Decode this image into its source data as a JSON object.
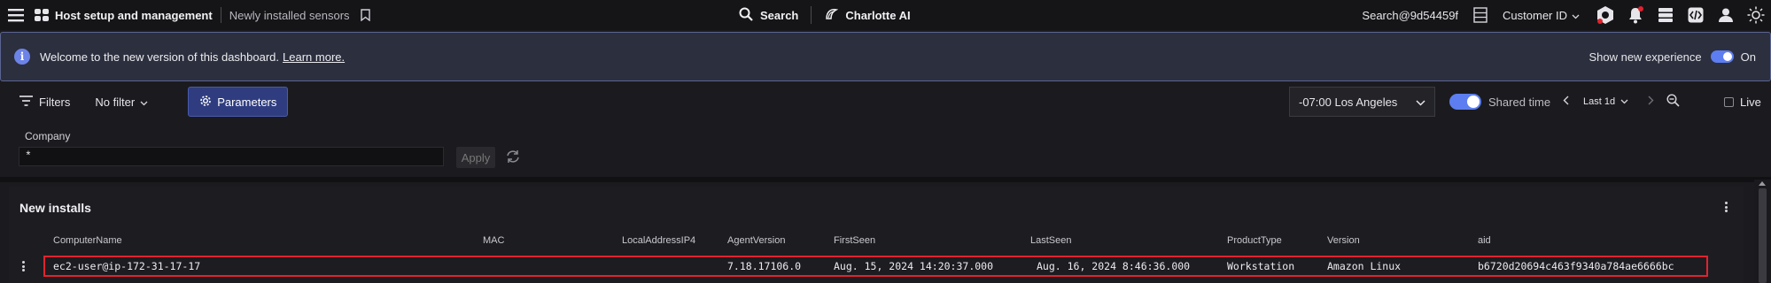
{
  "topbar": {
    "app_title": "Host setup and management",
    "subtitle": "Newly installed sensors",
    "search_label": "Search",
    "charlotte_label": "Charlotte AI",
    "search_id": "Search@9d54459f",
    "customer_label": "Customer ID"
  },
  "banner": {
    "message": "Welcome to the new version of this dashboard.",
    "link": "Learn more.",
    "toggle_label": "Show new experience",
    "toggle_state": "On"
  },
  "filterbar": {
    "filters_label": "Filters",
    "no_filter_label": "No filter",
    "parameters_label": "Parameters",
    "timezone": "-07:00 Los Angeles",
    "shared_time_label": "Shared time",
    "range": "Last 1d",
    "live_label": "Live"
  },
  "params": {
    "company_label": "Company",
    "company_value": "*",
    "apply_label": "Apply"
  },
  "panel": {
    "title": "New installs",
    "columns": [
      "ComputerName",
      "MAC",
      "LocalAddressIP4",
      "AgentVersion",
      "FirstSeen",
      "LastSeen",
      "ProductType",
      "Version",
      "aid"
    ],
    "rows": [
      {
        "ComputerName": "ec2-user@ip-172-31-17-17",
        "MAC": "",
        "LocalAddressIP4": "",
        "AgentVersion": "7.18.17106.0",
        "FirstSeen": "Aug. 15, 2024 14:20:37.000",
        "LastSeen": "Aug. 16, 2024 8:46:36.000",
        "ProductType": "Workstation",
        "Version": "Amazon Linux",
        "aid": "b6720d20694c463f9340a784ae6666bc"
      }
    ]
  },
  "colors": {
    "accent": "#5c7ef0",
    "highlight": "#e0232f",
    "notification": "#e0232f"
  }
}
